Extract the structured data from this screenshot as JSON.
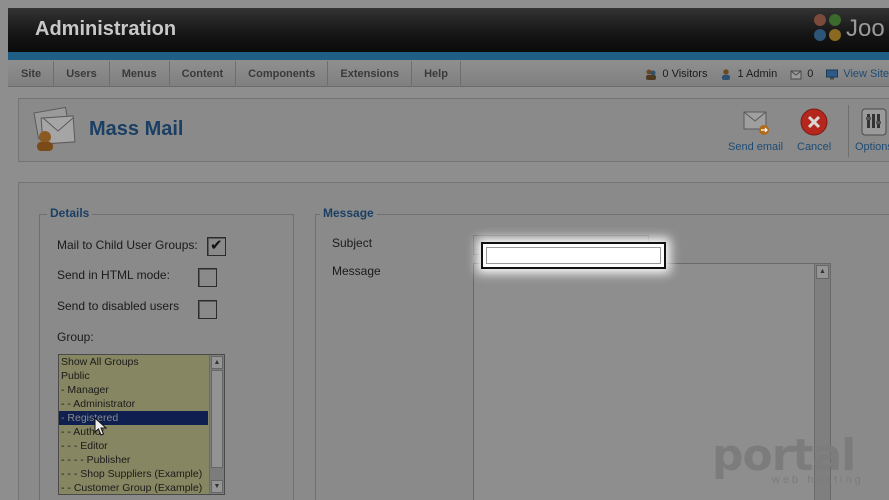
{
  "header": {
    "title": "Administration",
    "logo_text": "Joo"
  },
  "menu": {
    "items": [
      "Site",
      "Users",
      "Menus",
      "Content",
      "Components",
      "Extensions",
      "Help"
    ]
  },
  "status": {
    "visitors": "0 Visitors",
    "admins": "1 Admin",
    "messages": "0",
    "view_site": "View Site"
  },
  "toolbar": {
    "page_title": "Mass Mail",
    "send_email": "Send email",
    "cancel": "Cancel",
    "options": "Options"
  },
  "details": {
    "legend": "Details",
    "mail_child_groups": "Mail to Child User Groups:",
    "mail_child_groups_checked": true,
    "html_mode": "Send in HTML mode:",
    "html_mode_checked": false,
    "disabled_users": "Send to disabled users",
    "disabled_users_checked": false,
    "group_label": "Group:",
    "groups": [
      "Show All Groups",
      "Public",
      "- Manager",
      "- - Administrator",
      "- Registered",
      "- - Author",
      "- - - Editor",
      "- - - - Publisher",
      "- - - Shop Suppliers (Example)",
      "- - Customer Group (Example)"
    ],
    "selected_group": "- Registered"
  },
  "message": {
    "legend": "Message",
    "subject_label": "Subject",
    "subject_value": "",
    "message_label": "Message",
    "message_value": ""
  },
  "watermark": {
    "brand": "portal",
    "tagline": "web hosting"
  },
  "colors": {
    "accent_blue": "#1f5f86",
    "title_blue": "#1b3f64",
    "cancel_red": "#b5271d"
  }
}
